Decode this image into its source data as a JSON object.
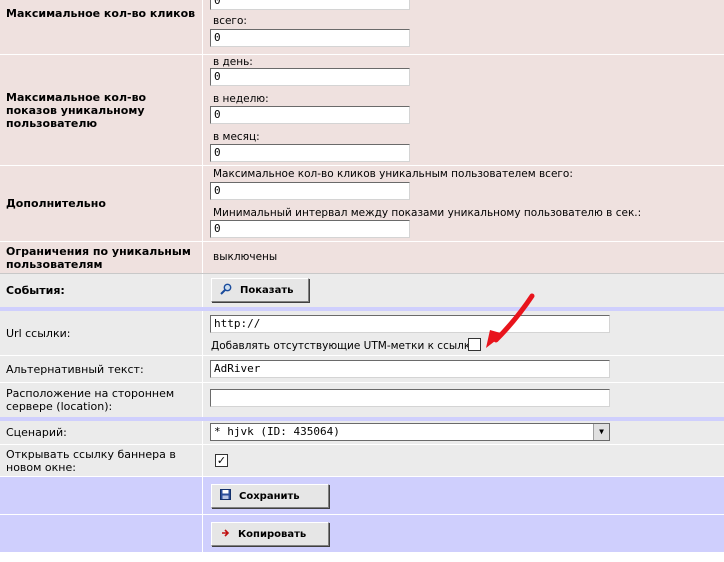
{
  "rows": {
    "max_clicks": {
      "label": "Максимальное кол-во кликов",
      "total_label": "всего:",
      "total_value": "0",
      "top_value": "0"
    },
    "max_impressions": {
      "label": "Максимальное кол-во показов уникальному пользователю",
      "per_day_label": "в день:",
      "per_day_value": "0",
      "per_week_label": "в неделю:",
      "per_week_value": "0",
      "per_month_label": "в месяц:",
      "per_month_value": "0"
    },
    "additional": {
      "label": "Дополнительно",
      "max_unique_clicks_label": "Максимальное кол-во кликов уникальным пользователем всего:",
      "max_unique_clicks_value": "0",
      "min_interval_label": "Минимальный интервал между показами уникальному пользователю в сек.:",
      "min_interval_value": "0"
    },
    "unique_limits": {
      "label": "Ограничения по уникальным пользователям",
      "value": "выключены"
    },
    "events": {
      "label": "События:",
      "button": "Показать"
    },
    "url": {
      "label": "Url ссылки:",
      "value": "http://",
      "utm_label": "Добавлять отсутствующие UTM-метки к ссылке",
      "utm_checked": false
    },
    "alt_text": {
      "label": "Альтернативный текст:",
      "value": "AdRiver"
    },
    "location": {
      "label": "Расположение на стороннем сервере (location):",
      "value": ""
    },
    "scenario": {
      "label": "Сценарий:",
      "value": "* hjvk (ID: 435064)"
    },
    "new_window": {
      "label": "Открывать ссылку баннера в новом окне:",
      "checked": true,
      "check_glyph": "✓"
    },
    "save": {
      "button": "Сохранить"
    },
    "copy": {
      "button": "Копировать"
    }
  },
  "colors": {
    "pink": "#efe1df",
    "gray": "#ebebeb",
    "blue": "#cfcffd",
    "arrow": "#e8141c"
  },
  "icons": {
    "events_button": "magnifier-icon",
    "save_button": "floppy-disk-icon",
    "copy_button": "red-arrow-icon",
    "annotation": "red-arrow-annotation"
  }
}
